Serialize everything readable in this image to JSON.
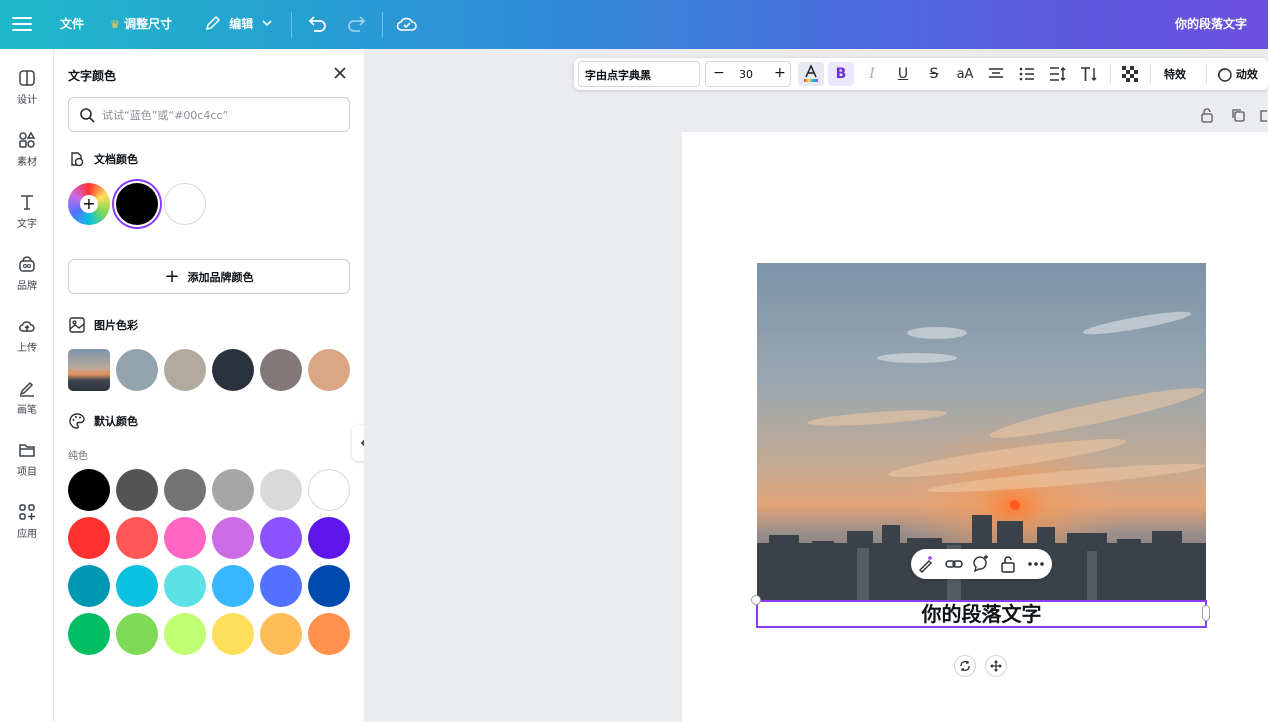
{
  "topbar": {
    "file": "文件",
    "resize": "调整尺寸",
    "edit": "编辑",
    "design_title": "你的段落文字"
  },
  "rail": [
    {
      "label": "设计",
      "icon": "layout-icon"
    },
    {
      "label": "素材",
      "icon": "shapes-icon"
    },
    {
      "label": "文字",
      "icon": "text-icon"
    },
    {
      "label": "品牌",
      "icon": "brand-icon"
    },
    {
      "label": "上传",
      "icon": "upload-cloud-icon"
    },
    {
      "label": "画笔",
      "icon": "pen-icon"
    },
    {
      "label": "项目",
      "icon": "folder-icon"
    },
    {
      "label": "应用",
      "icon": "apps-icon"
    }
  ],
  "panel": {
    "title": "文字颜色",
    "search_placeholder": "试试“蓝色”或“#00c4cc”",
    "doc_colors_title": "文档颜色",
    "doc_colors": [
      "#000000",
      "#ffffff"
    ],
    "add_brand_color": "添加品牌颜色",
    "image_colors_title": "图片色彩",
    "image_colors": [
      "#93a3ad",
      "#b3aa9f",
      "#2a333d",
      "#837877",
      "#dba684"
    ],
    "default_colors_title": "默认颜色",
    "solid_label": "纯色",
    "default_colors": [
      [
        "#000000",
        "#545454",
        "#737373",
        "#a6a6a6",
        "#d9d9d9",
        "#ffffff"
      ],
      [
        "#ff3131",
        "#ff5757",
        "#ff66c4",
        "#cb6ce6",
        "#8c52ff",
        "#5e17eb"
      ],
      [
        "#0097b2",
        "#0cc0df",
        "#5ce1e6",
        "#38b6ff",
        "#5271ff",
        "#004aad"
      ],
      [
        "#00bf63",
        "#7ed957",
        "#c1ff72",
        "#ffde59",
        "#ffbd59",
        "#ff914d"
      ]
    ]
  },
  "text_toolbar": {
    "font": "字由点字典黑",
    "size": "30",
    "bold": "B",
    "italic": "I",
    "underline": "U",
    "strike": "S",
    "case": "aA",
    "effects": "特效",
    "animate": "动效"
  },
  "canvas": {
    "text": "你的段落文字"
  },
  "colors": {
    "accent": "#8b3dff"
  }
}
